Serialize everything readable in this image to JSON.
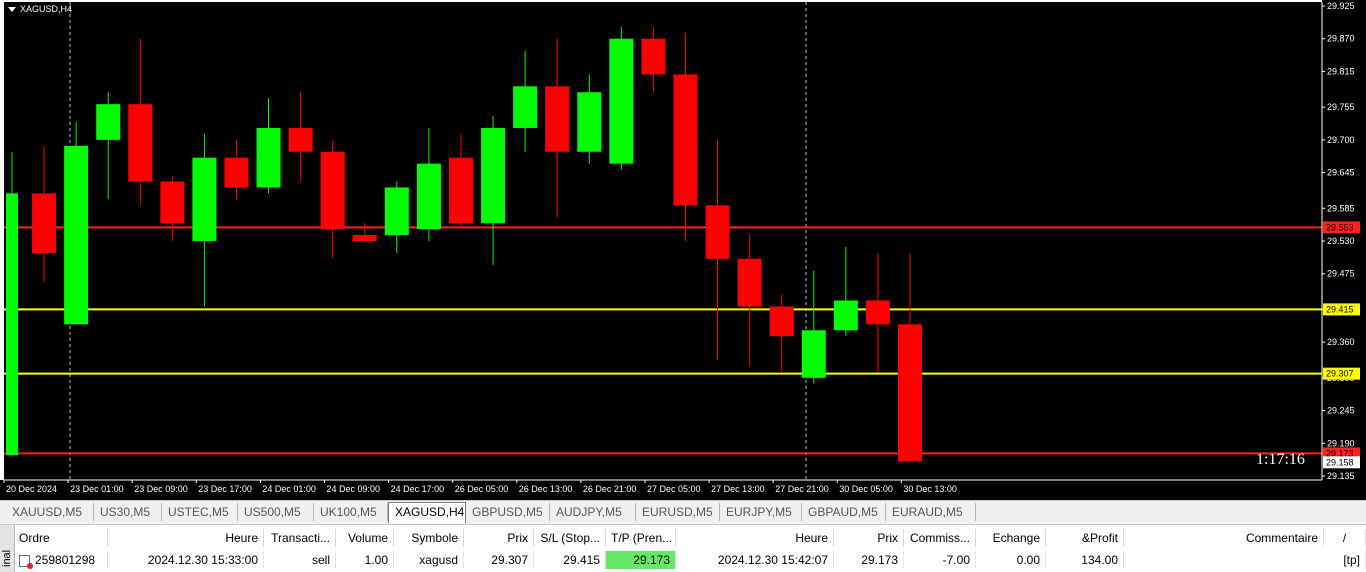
{
  "chart": {
    "title": "XAGUSD,H4",
    "countdown": "1:17:16",
    "colors": {
      "background": "#000000",
      "bull": "#00ff00",
      "bear": "#ff0000",
      "sl_line": "#ff2020",
      "tp_line": "#ff2020",
      "order_line": "#ffff00",
      "axis_text": "#ffffff",
      "period_separator": "#c0c0c0"
    },
    "price_levels": [
      {
        "name": "line-29-553",
        "price": 29.553,
        "label": "29.553",
        "color": "#ff2020"
      },
      {
        "name": "line-29-415",
        "price": 29.415,
        "label": "29.415",
        "color": "#ffff00"
      },
      {
        "name": "line-29-307",
        "price": 29.307,
        "label": "29.307",
        "color": "#ffff00"
      },
      {
        "name": "line-29-173",
        "price": 29.173,
        "label": "29.173",
        "color": "#ff2020"
      }
    ],
    "current_price_label": "29.158",
    "period_separators": [
      "23 Dec 01:00",
      "27 Dec 21:00"
    ]
  },
  "chart_data": {
    "type": "candlestick",
    "title": "XAGUSD,H4",
    "ylim": [
      29.13,
      29.93
    ],
    "y_ticks": [
      "29.925",
      "29.870",
      "29.815",
      "29.755",
      "29.700",
      "29.645",
      "29.585",
      "29.530",
      "29.475",
      "29.415",
      "29.360",
      "29.300",
      "29.245",
      "29.190",
      "29.135"
    ],
    "x_tick_labels": [
      "20 Dec 2024",
      "23 Dec 01:00",
      "23 Dec 09:00",
      "23 Dec 17:00",
      "24 Dec 01:00",
      "24 Dec 09:00",
      "24 Dec 17:00",
      "26 Dec 05:00",
      "26 Dec 13:00",
      "26 Dec 21:00",
      "27 Dec 05:00",
      "27 Dec 13:00",
      "27 Dec 21:00",
      "30 Dec 05:00",
      "30 Dec 13:00"
    ],
    "candles": [
      {
        "o": 29.17,
        "h": 29.68,
        "l": 29.17,
        "c": 29.61
      },
      {
        "o": 29.61,
        "h": 29.69,
        "l": 29.46,
        "c": 29.51
      },
      {
        "o": 29.39,
        "h": 29.73,
        "l": 29.39,
        "c": 29.69
      },
      {
        "o": 29.7,
        "h": 29.78,
        "l": 29.6,
        "c": 29.76
      },
      {
        "o": 29.76,
        "h": 29.87,
        "l": 29.59,
        "c": 29.63
      },
      {
        "o": 29.63,
        "h": 29.64,
        "l": 29.53,
        "c": 29.56
      },
      {
        "o": 29.53,
        "h": 29.71,
        "l": 29.42,
        "c": 29.67
      },
      {
        "o": 29.67,
        "h": 29.7,
        "l": 29.6,
        "c": 29.62
      },
      {
        "o": 29.62,
        "h": 29.77,
        "l": 29.61,
        "c": 29.72
      },
      {
        "o": 29.72,
        "h": 29.78,
        "l": 29.63,
        "c": 29.68
      },
      {
        "o": 29.68,
        "h": 29.7,
        "l": 29.5,
        "c": 29.55
      },
      {
        "o": 29.54,
        "h": 29.56,
        "l": 29.53,
        "c": 29.53
      },
      {
        "o": 29.54,
        "h": 29.63,
        "l": 29.51,
        "c": 29.62
      },
      {
        "o": 29.55,
        "h": 29.72,
        "l": 29.53,
        "c": 29.66
      },
      {
        "o": 29.67,
        "h": 29.71,
        "l": 29.55,
        "c": 29.56
      },
      {
        "o": 29.56,
        "h": 29.74,
        "l": 29.49,
        "c": 29.72
      },
      {
        "o": 29.72,
        "h": 29.85,
        "l": 29.68,
        "c": 29.79
      },
      {
        "o": 29.79,
        "h": 29.87,
        "l": 29.57,
        "c": 29.68
      },
      {
        "o": 29.68,
        "h": 29.81,
        "l": 29.66,
        "c": 29.78
      },
      {
        "o": 29.66,
        "h": 29.89,
        "l": 29.65,
        "c": 29.87
      },
      {
        "o": 29.87,
        "h": 29.89,
        "l": 29.78,
        "c": 29.81
      },
      {
        "o": 29.81,
        "h": 29.88,
        "l": 29.53,
        "c": 29.59
      },
      {
        "o": 29.59,
        "h": 29.7,
        "l": 29.33,
        "c": 29.5
      },
      {
        "o": 29.5,
        "h": 29.54,
        "l": 29.32,
        "c": 29.42
      },
      {
        "o": 29.42,
        "h": 29.44,
        "l": 29.31,
        "c": 29.37
      },
      {
        "o": 29.3,
        "h": 29.48,
        "l": 29.29,
        "c": 29.38
      },
      {
        "o": 29.38,
        "h": 29.52,
        "l": 29.37,
        "c": 29.43
      },
      {
        "o": 29.43,
        "h": 29.51,
        "l": 29.31,
        "c": 29.39
      },
      {
        "o": 29.39,
        "h": 29.51,
        "l": 29.16,
        "c": 29.16
      }
    ]
  },
  "tabs": [
    {
      "label": "XAUUSD,M5",
      "active": false
    },
    {
      "label": "US30,M5",
      "active": false
    },
    {
      "label": "USTEC,M5",
      "active": false
    },
    {
      "label": "US500,M5",
      "active": false
    },
    {
      "label": "UK100,M5",
      "active": false
    },
    {
      "label": "XAGUSD,H4",
      "active": true
    },
    {
      "label": "GBPUSD,M5",
      "active": false
    },
    {
      "label": "AUDJPY,M5",
      "active": false
    },
    {
      "label": "EURUSD,M5",
      "active": false
    },
    {
      "label": "EURJPY,M5",
      "active": false
    },
    {
      "label": "GBPAUD,M5",
      "active": false
    },
    {
      "label": "EURAUD,M5",
      "active": false
    }
  ],
  "terminal": {
    "side_label": "inal",
    "headers": [
      "Ordre",
      "Heure",
      "Transacti...",
      "Volume",
      "Symbole",
      "Prix",
      "S/L (Stop...",
      "T/P (Pren...",
      "Heure",
      "Prix",
      "Commiss...",
      "Echange",
      "&Profit",
      "Commentaire",
      "/"
    ],
    "row": {
      "order": "259801298",
      "open_time": "2024.12.30 15:33:00",
      "type": "sell",
      "volume": "1.00",
      "symbol": "xagusd",
      "open_price": "29.307",
      "sl": "29.415",
      "tp": "29.173",
      "close_time": "2024.12.30 15:42:07",
      "close_price": "29.173",
      "commission": "-7.00",
      "swap": "0.00",
      "profit": "134.00",
      "comment": "[tp]"
    }
  }
}
